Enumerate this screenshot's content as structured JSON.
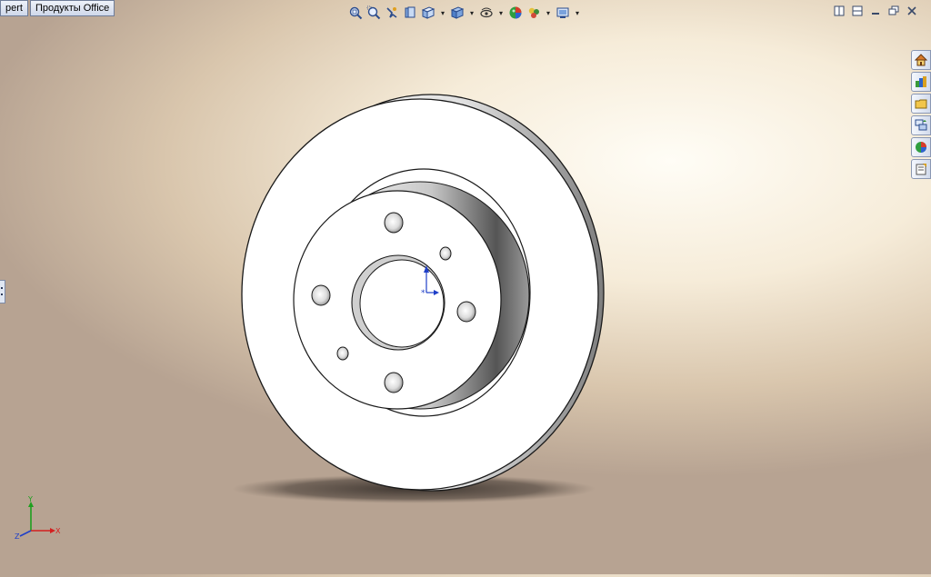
{
  "tabs": [
    "pert",
    "Продукты Office"
  ],
  "hud_toolbar": {
    "icons": [
      "zoom-to-fit-icon",
      "zoom-to-area-icon",
      "previous-view-icon",
      "section-view-icon",
      "view-orientation-icon",
      "display-style-icon",
      "hide-show-items-icon",
      "edit-appearance-icon",
      "apply-scene-icon",
      "view-settings-icon"
    ]
  },
  "window_controls": [
    "tile-horizontal-icon",
    "tile-vertical-icon",
    "minimize-icon",
    "restore-icon",
    "close-icon"
  ],
  "task_pane": [
    "solidworks-resources-icon",
    "design-library-icon",
    "file-explorer-icon",
    "view-palette-icon",
    "appearances-scenes-icon",
    "custom-properties-icon"
  ],
  "colors": {
    "tab_bg": "#dfe5f2",
    "part_face": "#ffffff",
    "part_edge": "#1a1a1a",
    "x_axis": "#d42020",
    "y_axis": "#1ea01e",
    "z_axis": "#1f3fc8",
    "origin": "#1f3fc8"
  },
  "triad": {
    "x_label": "X",
    "y_label": "Y",
    "z_label": "Z"
  }
}
